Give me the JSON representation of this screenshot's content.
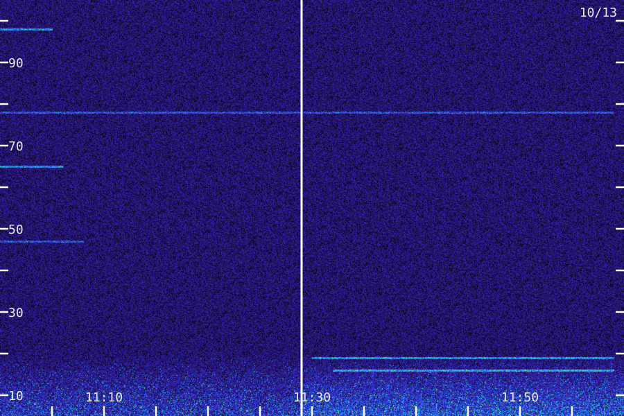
{
  "chart_data": {
    "type": "heatmap",
    "title": "",
    "xlabel": "",
    "ylabel": "",
    "date_label": "10/13",
    "y_axis": {
      "range": [
        5,
        105
      ],
      "labeled_ticks": [
        10,
        30,
        50,
        70,
        90
      ],
      "label_text": [
        "10",
        "30",
        "50",
        "70",
        "90"
      ],
      "minor_ticks": [
        20,
        40,
        60,
        80,
        100
      ]
    },
    "x_axis": {
      "range": [
        "11:00",
        "11:59"
      ],
      "labeled_ticks": [
        "11:10",
        "11:30",
        "11:50"
      ],
      "minor_ticks": [
        "11:05",
        "11:15",
        "11:20",
        "11:25",
        "11:35",
        "11:40",
        "11:45",
        "11:55"
      ],
      "marker_line": "11:29"
    },
    "colormap": [
      "#000000",
      "#1a0a40",
      "#2a1a8a",
      "#3a2ad0",
      "#1e6eff",
      "#10d0f0",
      "#40f070",
      "#c0f040"
    ],
    "emission_lines": [
      {
        "y": 98,
        "x_range": [
          "11:00",
          "11:05"
        ],
        "intensity": "strong"
      },
      {
        "y": 78,
        "x_range": [
          "11:00",
          "11:59"
        ],
        "intensity": "medium"
      },
      {
        "y": 65,
        "x_range": [
          "11:00",
          "11:06"
        ],
        "intensity": "strong"
      },
      {
        "y": 47,
        "x_range": [
          "11:00",
          "11:08"
        ],
        "intensity": "medium"
      },
      {
        "y": 19,
        "x_range": [
          "11:30",
          "11:59"
        ],
        "intensity": "strong"
      },
      {
        "y": 16,
        "x_range": [
          "11:32",
          "11:59"
        ],
        "intensity": "strong"
      }
    ],
    "low_band_noise_below": 20
  }
}
